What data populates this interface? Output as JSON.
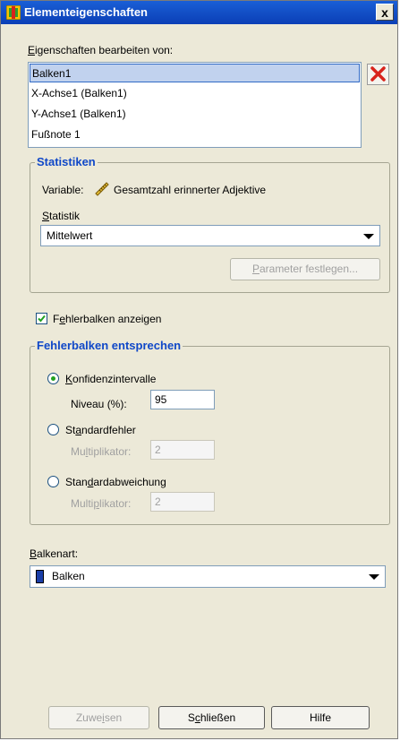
{
  "window": {
    "title": "Elementeigenschaften",
    "close_label": "x"
  },
  "edit_properties": {
    "label_prefix": "E",
    "label_rest": "igenschaften bearbeiten von:",
    "items": [
      {
        "label": "Balken1",
        "selected": true
      },
      {
        "label": "X-Achse1 (Balken1)",
        "selected": false
      },
      {
        "label": "Y-Achse1 (Balken1)",
        "selected": false
      },
      {
        "label": "Fußnote 1",
        "selected": false
      }
    ],
    "delete_icon": "red-x-icon"
  },
  "statistics": {
    "title": "Statistiken",
    "variable_label": "Variable:",
    "variable_icon": "ruler-icon",
    "variable_value": "Gesamtzahl erinnerter Adjektive",
    "statistic_label_prefix": "S",
    "statistic_label_rest": "tatistik",
    "statistic_value": "Mittelwert",
    "param_button_prefix": "P",
    "param_button_rest": "arameter festlegen..."
  },
  "errorbars": {
    "show_prefix": "F",
    "show_underlined": "e",
    "show_rest": "hlerbalken anzeigen",
    "show_checked": true,
    "group_title": "Fehlerbalken entsprechen",
    "conf_prefix": "K",
    "conf_rest": "onfidenzintervalle",
    "level_label": "Niveau (%):",
    "level_value": "95",
    "se_pre": "St",
    "se_u": "a",
    "se_rest": "ndardfehler",
    "se_mult_pre": "Mu",
    "se_mult_u": "l",
    "se_mult_rest": "tiplikator:",
    "se_mult_value": "2",
    "sd_pre": "Stan",
    "sd_u": "d",
    "sd_rest": "ardabweichung",
    "sd_mult_pre": "Multi",
    "sd_mult_u": "p",
    "sd_mult_rest": "likator:",
    "sd_mult_value": "2",
    "selected": "conf"
  },
  "bar_style": {
    "label_prefix": "B",
    "label_rest": "alkenart:",
    "value": "Balken",
    "swatch_color": "#1a3ea8"
  },
  "footer": {
    "apply_pre": "Zuwe",
    "apply_u": "i",
    "apply_rest": "sen",
    "close_pre": "S",
    "close_u": "c",
    "close_rest": "hließen",
    "help": "Hilfe"
  },
  "colors": {
    "title_bar": "#0b3fb6",
    "group_title": "#1048c8",
    "selection": "#c1d2ee"
  }
}
